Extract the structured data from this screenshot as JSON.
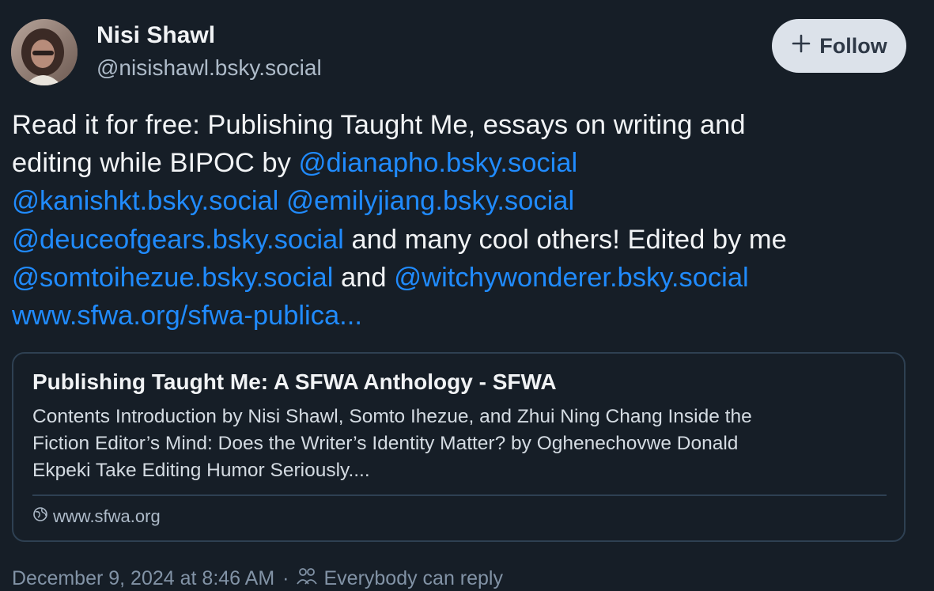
{
  "author": {
    "display_name": "Nisi Shawl",
    "handle": "@nisishawl.bsky.social",
    "follow_label": "Follow"
  },
  "post": {
    "text_1": "Read it for free: Publishing Taught Me, essays on writing and",
    "text_2": "editing while BIPOC by",
    "mention_1": "@dianapho.bsky.social",
    "mention_2": "@kanishkt.bsky.social",
    "mention_3": "@emilyjiang.bsky.social",
    "mention_4": "@deuceofgears.bsky.social",
    "text_3": "and many cool others! Edited by me",
    "mention_5": "@somtoihezue.bsky.social",
    "text_4": "and",
    "mention_6": "@witchywonderer.bsky.social",
    "link": "www.sfwa.org/sfwa-publica..."
  },
  "card": {
    "title": "Publishing Taught Me: A SFWA Anthology - SFWA",
    "desc_1": "Contents Introduction by Nisi Shawl, Somto Ihezue, and Zhui Ning Chang Inside the",
    "desc_2": "Fiction Editor’s Mind: Does the Writer’s Identity Matter?  by Oghenechovwe Donald",
    "desc_3": "Ekpeki Take Editing Humor Seriously....",
    "domain": "www.sfwa.org"
  },
  "meta": {
    "timestamp": "December 9, 2024 at 8:46 AM",
    "separator": "·",
    "reply_setting": "Everybody can reply"
  },
  "icons": {
    "follow": "plus-icon",
    "domain": "globe-icon",
    "reply": "people-icon"
  },
  "colors": {
    "background": "#161e27",
    "link": "#208bfe",
    "follow_button_bg": "#dce2ea",
    "border": "#2e4052"
  }
}
